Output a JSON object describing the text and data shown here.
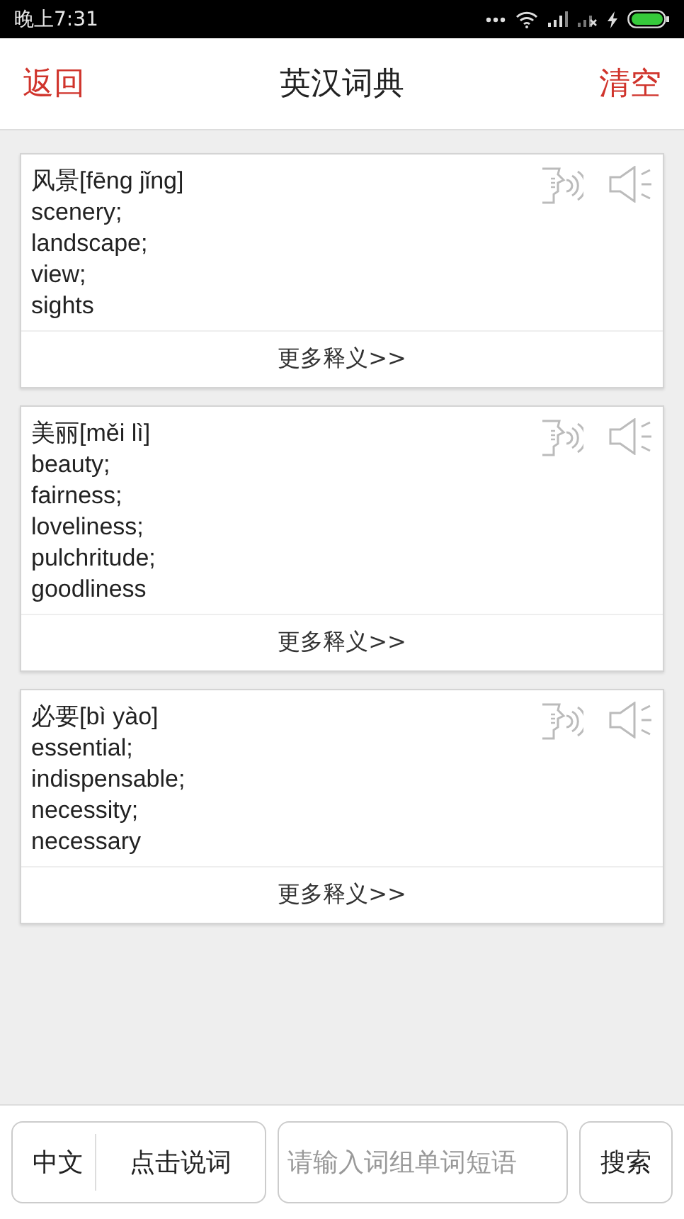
{
  "status_bar": {
    "time": "晚上7:31"
  },
  "header": {
    "back": "返回",
    "title": "英汉词典",
    "clear": "清空"
  },
  "entries": [
    {
      "headword": "风景[fēng jǐng]",
      "definitions": [
        "scenery;",
        "landscape;",
        "view;",
        "sights"
      ],
      "more": "更多释义>>"
    },
    {
      "headword": "美丽[měi lì]",
      "definitions": [
        "beauty;",
        "fairness;",
        "loveliness;",
        "pulchritude;",
        "goodliness"
      ],
      "more": "更多释义>>"
    },
    {
      "headword": "必要[bì yào]",
      "definitions": [
        "essential;",
        "indispensable;",
        "necessity;",
        "necessary"
      ],
      "more": "更多释义>>"
    }
  ],
  "bottom_bar": {
    "language": "中文",
    "voice": "点击说词",
    "search": {
      "placeholder": "请输入词组单词短语"
    },
    "search_button": "搜索"
  }
}
